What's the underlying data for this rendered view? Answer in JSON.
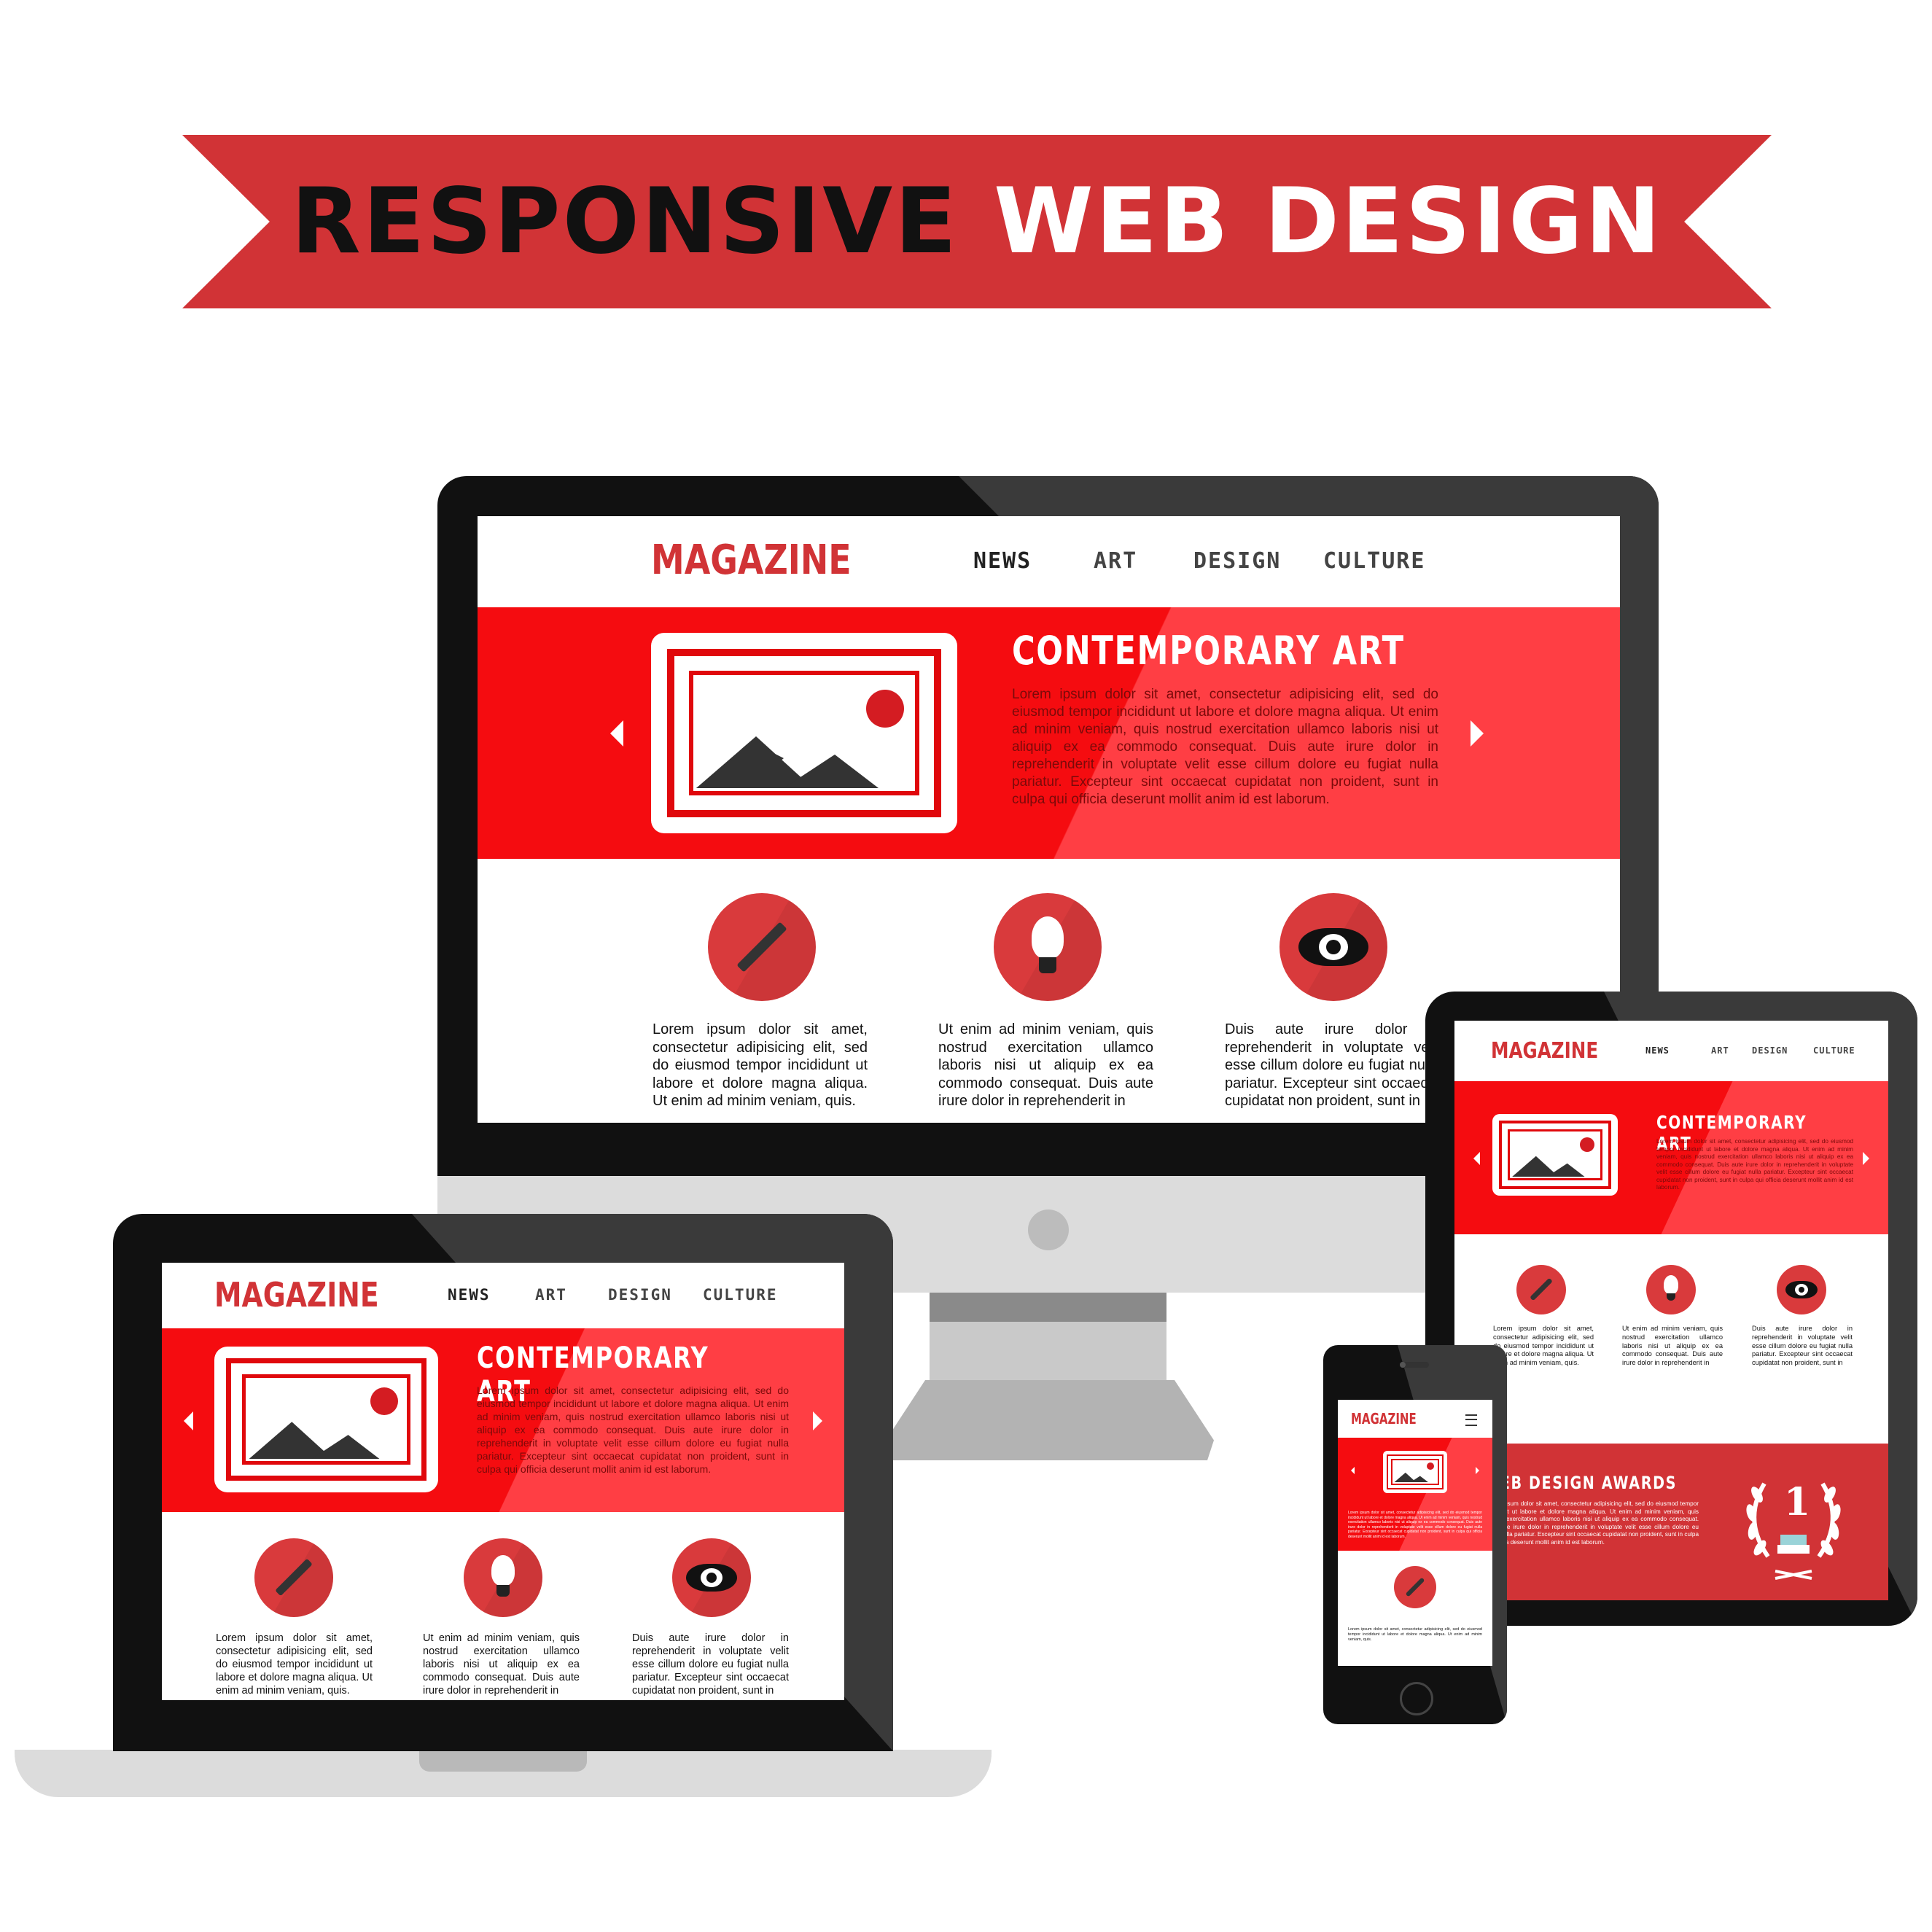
{
  "banner": {
    "word1": "RESPONSIVE",
    "word2": "WEB DESIGN"
  },
  "site": {
    "logo": "MAGAZINE",
    "nav": [
      "NEWS",
      "ART",
      "DESIGN",
      "CULTURE"
    ],
    "hero_title": "CONTEMPORARY ART",
    "hero_body": "Lorem ipsum dolor sit amet, consectetur adipisicing elit, sed do eiusmod tempor incididunt ut labore et dolore magna aliqua. Ut enim ad minim veniam, quis nostrud exercitation ullamco laboris nisi ut aliquip ex ea commodo consequat. Duis aute irure dolor in reprehenderit in voluptate velit esse cillum dolore eu fugiat nulla pariatur. Excepteur sint occaecat cupidatat non proident, sunt in culpa qui officia deserunt mollit anim id est laborum.",
    "features": [
      {
        "icon": "pencil-icon",
        "text": "Lorem ipsum dolor sit amet, consectetur adipisicing elit, sed do eiusmod tempor incididunt ut labore et dolore magna aliqua. Ut enim ad minim veniam, quis."
      },
      {
        "icon": "lightbulb-icon",
        "text": "Ut enim ad minim veniam, quis nostrud exercitation ullamco laboris nisi ut aliquip ex ea commodo consequat. Duis aute irure dolor in reprehenderit in"
      },
      {
        "icon": "eye-icon",
        "text": "Duis aute irure dolor in reprehenderit in voluptate velit esse cillum dolore eu fugiat nulla pariatur. Excepteur sint occaecat cupidatat non proident, sunt in"
      }
    ],
    "awards_title": "WEB DESIGN AWARDS",
    "awards_body": "Lorem ipsum dolor sit amet, consectetur adipisicing elit, sed do eiusmod tempor incididunt ut labore et dolore magna aliqua. Ut enim ad minim veniam, quis nostrud exercitation ullamco laboris nisi ut aliquip ex ea commodo consequat. Duis aute irure dolor in reprehenderit in voluptate velit esse cillum dolore eu fugiat nulla pariatur. Excepteur sint occaecat cupidatat non proident, sunt in culpa qui officia deserunt mollit anim id est laborum.",
    "award_rank": "1"
  },
  "colors": {
    "brand_red": "#d13336",
    "hero_red": "#f50c10",
    "bezel": "#111111",
    "silver": "#d9d9d9"
  }
}
